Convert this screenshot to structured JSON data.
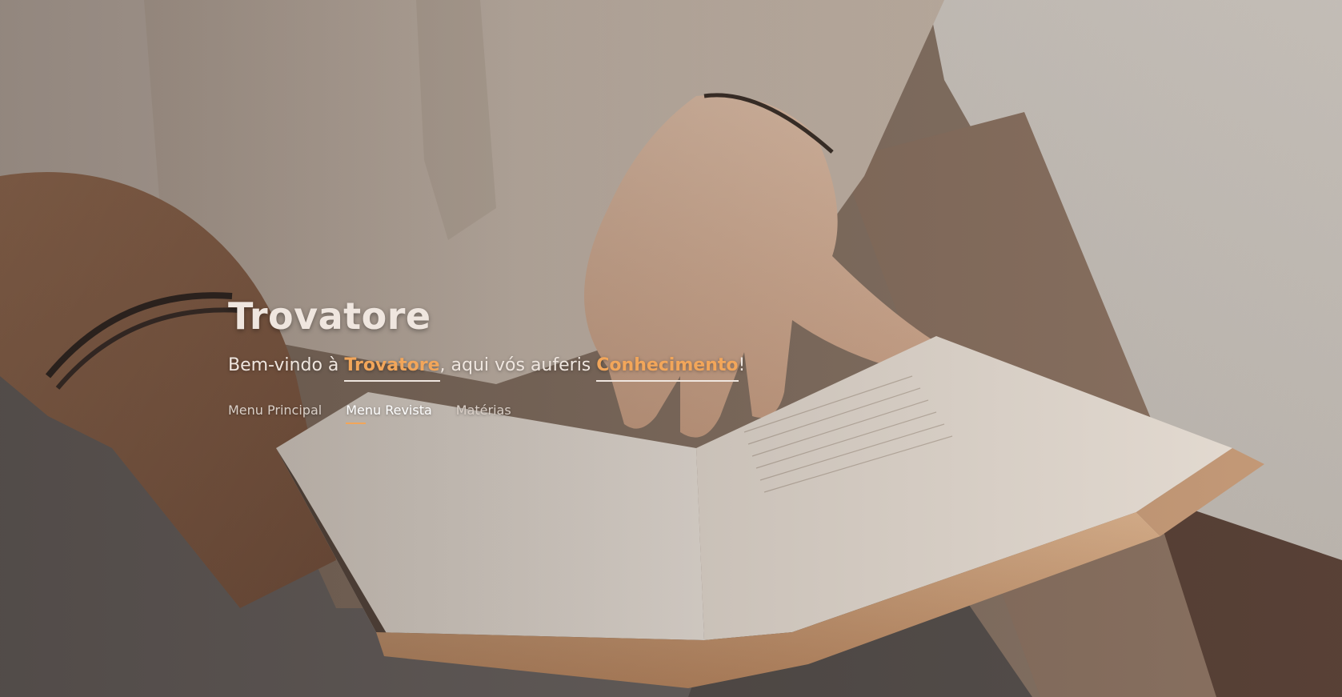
{
  "hero": {
    "title": "Trovatore",
    "tagline": {
      "prefix": "Bem-vindo à ",
      "highlight1": "Trovatore",
      "middle": ", aqui vós auferis ",
      "highlight2": "Conhecimento",
      "suffix": "!"
    },
    "accent_color": "#f2a65a",
    "background_image": "person-reading-open-book"
  },
  "nav": {
    "items": [
      {
        "label": "Menu Principal",
        "active": false
      },
      {
        "label": "Menu Revista",
        "active": true
      },
      {
        "label": "Matérias",
        "active": false
      }
    ]
  }
}
